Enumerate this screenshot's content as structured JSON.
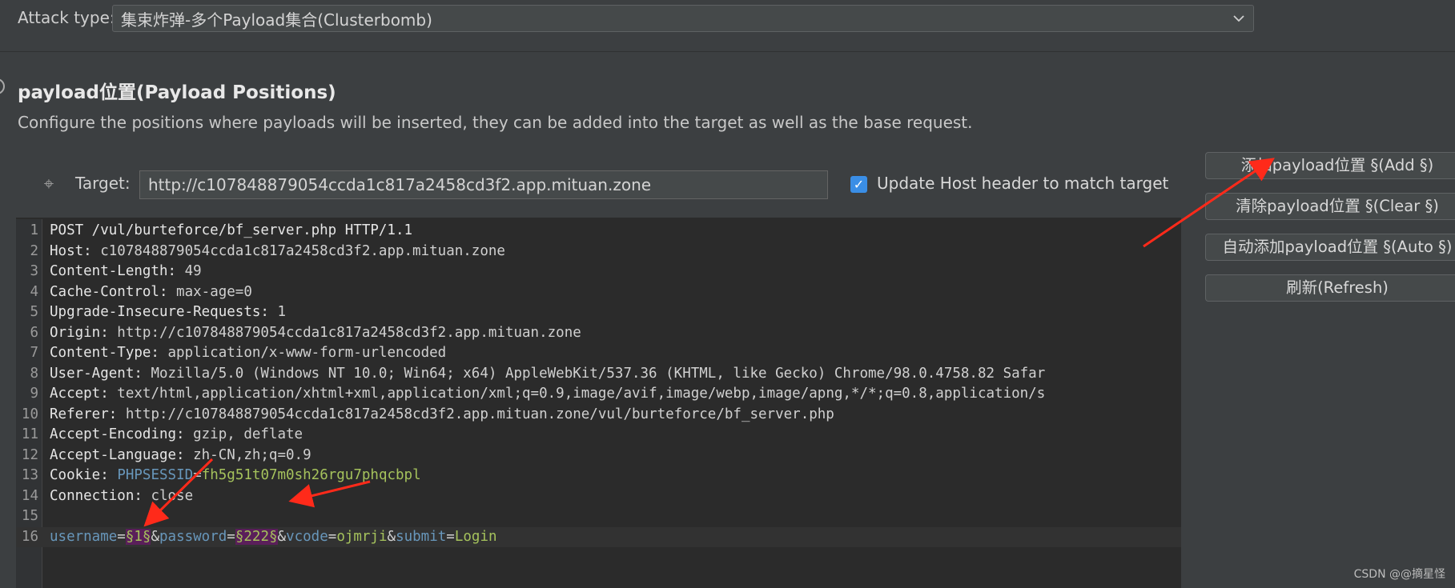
{
  "attack": {
    "label": "Attack type:",
    "value": "集束炸弹-多个Payload集合(Clusterbomb)"
  },
  "section": {
    "title": "payload位置(Payload Positions)",
    "description": "Configure the positions where payloads will be inserted, they can be added into the target as well as the base request."
  },
  "target": {
    "label": "Target:",
    "value": "http://c107848879054ccda1c817a2458cd3f2.app.mituan.zone",
    "update_host_label": "Update Host header to match target",
    "update_host_checked": true
  },
  "request_lines": [
    {
      "n": "1",
      "parts": [
        {
          "t": "POST /vul/burteforce/bf_server.php HTTP/1.1",
          "c": "hname"
        }
      ]
    },
    {
      "n": "2",
      "parts": [
        {
          "t": "Host:",
          "c": "hname"
        },
        {
          "t": " c107848879054ccda1c817a2458cd3f2.app.mituan.zone",
          "c": "hval"
        }
      ]
    },
    {
      "n": "3",
      "parts": [
        {
          "t": "Content-Length:",
          "c": "hname"
        },
        {
          "t": " 49",
          "c": "hval"
        }
      ]
    },
    {
      "n": "4",
      "parts": [
        {
          "t": "Cache-Control:",
          "c": "hname"
        },
        {
          "t": " max-age=0",
          "c": "hval"
        }
      ]
    },
    {
      "n": "5",
      "parts": [
        {
          "t": "Upgrade-Insecure-Requests:",
          "c": "hname"
        },
        {
          "t": " 1",
          "c": "hval"
        }
      ]
    },
    {
      "n": "6",
      "parts": [
        {
          "t": "Origin:",
          "c": "hname"
        },
        {
          "t": " http://c107848879054ccda1c817a2458cd3f2.app.mituan.zone",
          "c": "hval"
        }
      ]
    },
    {
      "n": "7",
      "parts": [
        {
          "t": "Content-Type:",
          "c": "hname"
        },
        {
          "t": " application/x-www-form-urlencoded",
          "c": "hval"
        }
      ]
    },
    {
      "n": "8",
      "parts": [
        {
          "t": "User-Agent:",
          "c": "hname"
        },
        {
          "t": " Mozilla/5.0 (Windows NT 10.0; Win64; x64) AppleWebKit/537.36 (KHTML, like Gecko) Chrome/98.0.4758.82 Safar",
          "c": "hval"
        }
      ]
    },
    {
      "n": "9",
      "parts": [
        {
          "t": "Accept:",
          "c": "hname"
        },
        {
          "t": " text/html,application/xhtml+xml,application/xml;q=0.9,image/avif,image/webp,image/apng,*/*;q=0.8,application/s",
          "c": "hval"
        }
      ]
    },
    {
      "n": "10",
      "parts": [
        {
          "t": "Referer:",
          "c": "hname"
        },
        {
          "t": " http://c107848879054ccda1c817a2458cd3f2.app.mituan.zone/vul/burteforce/bf_server.php",
          "c": "hval"
        }
      ]
    },
    {
      "n": "11",
      "parts": [
        {
          "t": "Accept-Encoding:",
          "c": "hname"
        },
        {
          "t": " gzip, deflate",
          "c": "hval"
        }
      ]
    },
    {
      "n": "12",
      "parts": [
        {
          "t": "Accept-Language:",
          "c": "hname"
        },
        {
          "t": " zh-CN,zh;q=0.9",
          "c": "hval"
        }
      ]
    },
    {
      "n": "13",
      "parts": [
        {
          "t": "Cookie:",
          "c": "hname"
        },
        {
          "t": " ",
          "c": "hval"
        },
        {
          "t": "PHPSESSID",
          "c": "cookie-name"
        },
        {
          "t": "=",
          "c": "eq"
        },
        {
          "t": "fh5g51t07m0sh26rgu7phqcbpl",
          "c": "cookie-val"
        }
      ]
    },
    {
      "n": "14",
      "parts": [
        {
          "t": "Connection:",
          "c": "hname"
        },
        {
          "t": " close",
          "c": "hval"
        }
      ]
    },
    {
      "n": "15",
      "parts": []
    },
    {
      "n": "16",
      "current": true,
      "parts": [
        {
          "t": "username",
          "c": "param-name"
        },
        {
          "t": "=",
          "c": "eq"
        },
        {
          "t": "§1§",
          "c": "marker"
        },
        {
          "t": "&",
          "c": "amp"
        },
        {
          "t": "password",
          "c": "param-name"
        },
        {
          "t": "=",
          "c": "eq"
        },
        {
          "t": "§222§",
          "c": "marker"
        },
        {
          "t": "&",
          "c": "amp"
        },
        {
          "t": "vcode",
          "c": "param-name"
        },
        {
          "t": "=",
          "c": "eq"
        },
        {
          "t": "ojmrji",
          "c": "param-val"
        },
        {
          "t": "&",
          "c": "amp"
        },
        {
          "t": "submit",
          "c": "param-name"
        },
        {
          "t": "=",
          "c": "eq"
        },
        {
          "t": "Login",
          "c": "param-val"
        }
      ]
    }
  ],
  "buttons": {
    "add": "添加payload位置 §(Add §)",
    "clear": "清除payload位置 §(Clear §)",
    "auto": "自动添加payload位置 §(Auto §)",
    "refresh": "刷新(Refresh)"
  },
  "watermark": "CSDN @@摘星怪",
  "colors": {
    "accent": "#3a8ee6",
    "arrow": "#ff2a1a",
    "marker_bg": "#5a1f5a"
  }
}
